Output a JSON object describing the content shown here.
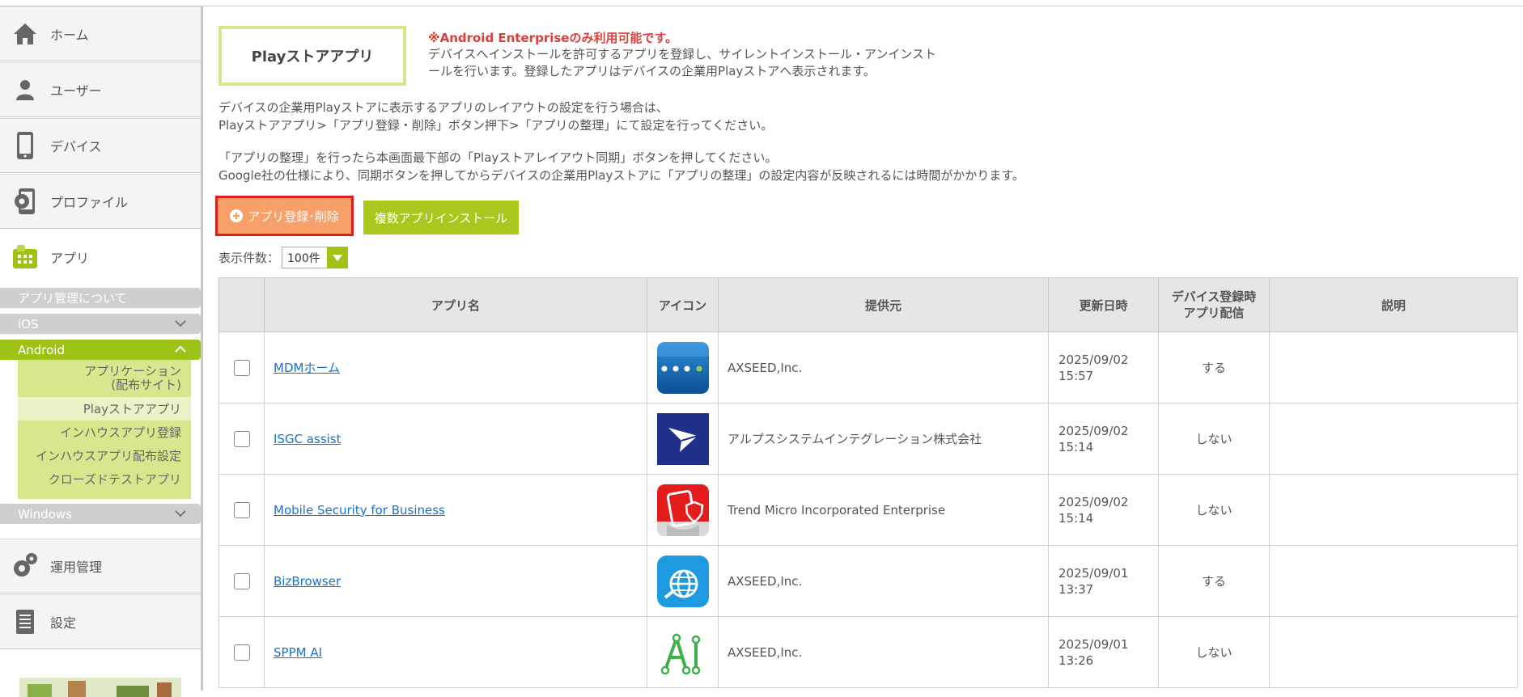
{
  "sidebar": {
    "items": [
      {
        "label": "ホーム",
        "icon": "home-icon"
      },
      {
        "label": "ユーザー",
        "icon": "user-icon"
      },
      {
        "label": "デバイス",
        "icon": "smartphone-icon"
      },
      {
        "label": "プロファイル",
        "icon": "profile-gear-icon"
      },
      {
        "label": "アプリ",
        "icon": "app-icon"
      },
      {
        "label": "運用管理",
        "icon": "gears-icon"
      },
      {
        "label": "設定",
        "icon": "document-icon"
      }
    ],
    "app_sub": {
      "about": "アプリ管理について",
      "ios": "iOS",
      "android": "Android",
      "android_links": [
        "アプリケーション\n(配布サイト)",
        "Playストアアプリ",
        "インハウスアプリ登録",
        "インハウスアプリ配布設定",
        "クローズドテストアプリ"
      ],
      "windows": "Windows"
    }
  },
  "main": {
    "page_title": "Playストアアプリ",
    "notice": "※Android Enterpriseのみ利用可能です。",
    "desc_line1": "デバイスへインストールを許可するアプリを登録し、サイレントインストール・アンインスト",
    "desc_line2": "ールを行います。登録したアプリはデバイスの企業用Playストアへ表示されます。",
    "para1_line1": "デバイスの企業用Playストアに表示するアプリのレイアウトの設定を行う場合は、",
    "para1_line2": "Playストアアプリ>「アプリ登録・削除」ボタン押下>「アプリの整理」にて設定を行ってください。",
    "para2_line1": "「アプリの整理」を行ったら本画面最下部の「Playストアレイアウト同期」ボタンを押してください。",
    "para2_line2": "Google社の仕様により、同期ボタンを押してからデバイスの企業用Playストアに「アプリの整理」の設定内容が反映されるには時間がかかります。",
    "btn_register": "アプリ登録･削除",
    "btn_multi": "複数アプリインストール",
    "count_label": "表示件数：",
    "count_value": "100件"
  },
  "table": {
    "headers": {
      "name": "アプリ名",
      "icon": "アイコン",
      "vendor": "提供元",
      "updated": "更新日時",
      "deploy_l1": "デバイス登録時",
      "deploy_l2": "アプリ配信",
      "desc": "説明"
    },
    "rows": [
      {
        "name": "MDMホーム",
        "icon": "mdm-home-app-icon",
        "vendor": "AXSEED,Inc.",
        "date": "2025/09/02",
        "time": "15:57",
        "deploy": "する",
        "desc": ""
      },
      {
        "name": "ISGC assist",
        "icon": "isgc-assist-app-icon",
        "vendor": "アルプスシステムインテグレーション株式会社",
        "date": "2025/09/02",
        "time": "15:14",
        "deploy": "しない",
        "desc": ""
      },
      {
        "name": "Mobile Security for Business",
        "icon": "mobile-security-app-icon",
        "vendor": "Trend Micro Incorporated Enterprise",
        "date": "2025/09/02",
        "time": "15:14",
        "deploy": "しない",
        "desc": ""
      },
      {
        "name": "BizBrowser",
        "icon": "bizbrowser-app-icon",
        "vendor": "AXSEED,Inc.",
        "date": "2025/09/01",
        "time": "13:37",
        "deploy": "する",
        "desc": ""
      },
      {
        "name": "SPPM AI",
        "icon": "sppm-ai-app-icon",
        "vendor": "AXSEED,Inc.",
        "date": "2025/09/01",
        "time": "13:26",
        "deploy": "しない",
        "desc": ""
      }
    ]
  },
  "colors": {
    "accent_green": "#9dc316",
    "register_button": "#f7a06a",
    "notice_red": "#d9403a",
    "link_blue": "#1a72c9"
  }
}
